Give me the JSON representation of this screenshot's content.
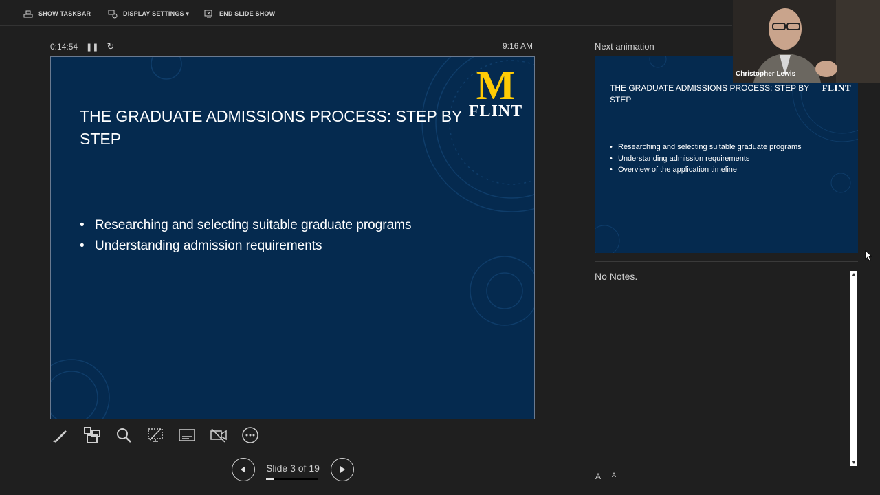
{
  "toolbar": {
    "show_taskbar": "SHOW TASKBAR",
    "display_settings": "DISPLAY SETTINGS ▾",
    "end_slide_show": "END SLIDE SHOW"
  },
  "timer": {
    "elapsed": "0:14:54"
  },
  "clock": "9:16 AM",
  "current_slide": {
    "title": "THE GRADUATE ADMISSIONS PROCESS: STEP BY STEP",
    "bullets": [
      "Researching and selecting suitable graduate programs",
      "Understanding admission requirements"
    ],
    "logo_mark": "M",
    "logo_text": "FLINT"
  },
  "navigation": {
    "label": "Slide 3 of 19",
    "progress_fraction": 0.158
  },
  "next_panel": {
    "label": "Next animation",
    "title": "THE GRADUATE ADMISSIONS PROCESS: STEP BY STEP",
    "logo_text": "FLINT",
    "bullets": [
      "Researching and selecting suitable graduate programs",
      "Understanding admission requirements",
      "Overview of the application timeline"
    ]
  },
  "notes": {
    "text": "No Notes."
  },
  "font_controls": {
    "increase": "A",
    "decrease": "A"
  },
  "video": {
    "participant_name": "Christopher Lewis"
  },
  "colors": {
    "slide_bg": "#052a4f",
    "logo_yellow": "#ffcb05",
    "app_bg": "#1f1f1f"
  }
}
